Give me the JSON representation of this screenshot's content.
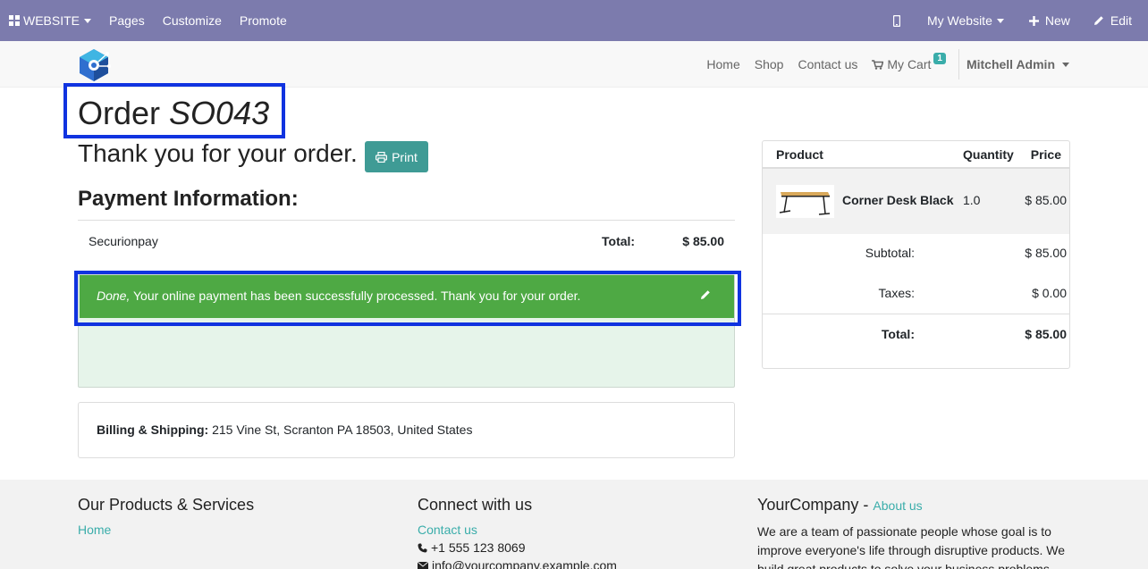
{
  "adminbar": {
    "website_label": "WEBSITE",
    "pages_label": "Pages",
    "customize_label": "Customize",
    "promote_label": "Promote",
    "my_website_label": "My Website",
    "new_label": "New",
    "edit_label": "Edit"
  },
  "header": {
    "nav": {
      "home": "Home",
      "shop": "Shop",
      "contact": "Contact us",
      "cart": "My Cart",
      "cart_count": "1",
      "user": "Mitchell Admin"
    }
  },
  "order": {
    "title_prefix": "Order",
    "order_number": "SO043",
    "thanks": "Thank you for your order.",
    "print_label": "Print"
  },
  "payment": {
    "heading": "Payment Information:",
    "method": "Securionpay",
    "total_label": "Total:",
    "total_value": "$ 85.00",
    "success_status": "Done,",
    "success_message": "Your online payment has been successfully processed. Thank you for your order."
  },
  "billing": {
    "label": "Billing & Shipping:",
    "address": "215 Vine St, Scranton PA 18503, United States"
  },
  "summary": {
    "headers": {
      "product": "Product",
      "quantity": "Quantity",
      "price": "Price"
    },
    "item": {
      "name": "Corner Desk Black",
      "qty": "1.0",
      "price": "$ 85.00"
    },
    "subtotal_label": "Subtotal:",
    "subtotal_value": "$ 85.00",
    "taxes_label": "Taxes:",
    "taxes_value": "$ 0.00",
    "total_label": "Total:",
    "total_value": "$ 85.00"
  },
  "footer": {
    "col1": {
      "heading": "Our Products & Services",
      "link_home": "Home"
    },
    "col2": {
      "heading": "Connect with us",
      "contact": "Contact us",
      "phone": "+1 555 123 8069",
      "email": "info@yourcompany.example.com"
    },
    "col3": {
      "heading": "YourCompany",
      "separator": " - ",
      "about": "About us",
      "text": "We are a team of passionate people whose goal is to improve everyone's life through disruptive products. We build great products to solve your business problems."
    }
  },
  "colors": {
    "adminbar": "#7c7bad",
    "accent": "#3aadaa",
    "success": "#4ea944",
    "highlight": "#1033e0"
  }
}
